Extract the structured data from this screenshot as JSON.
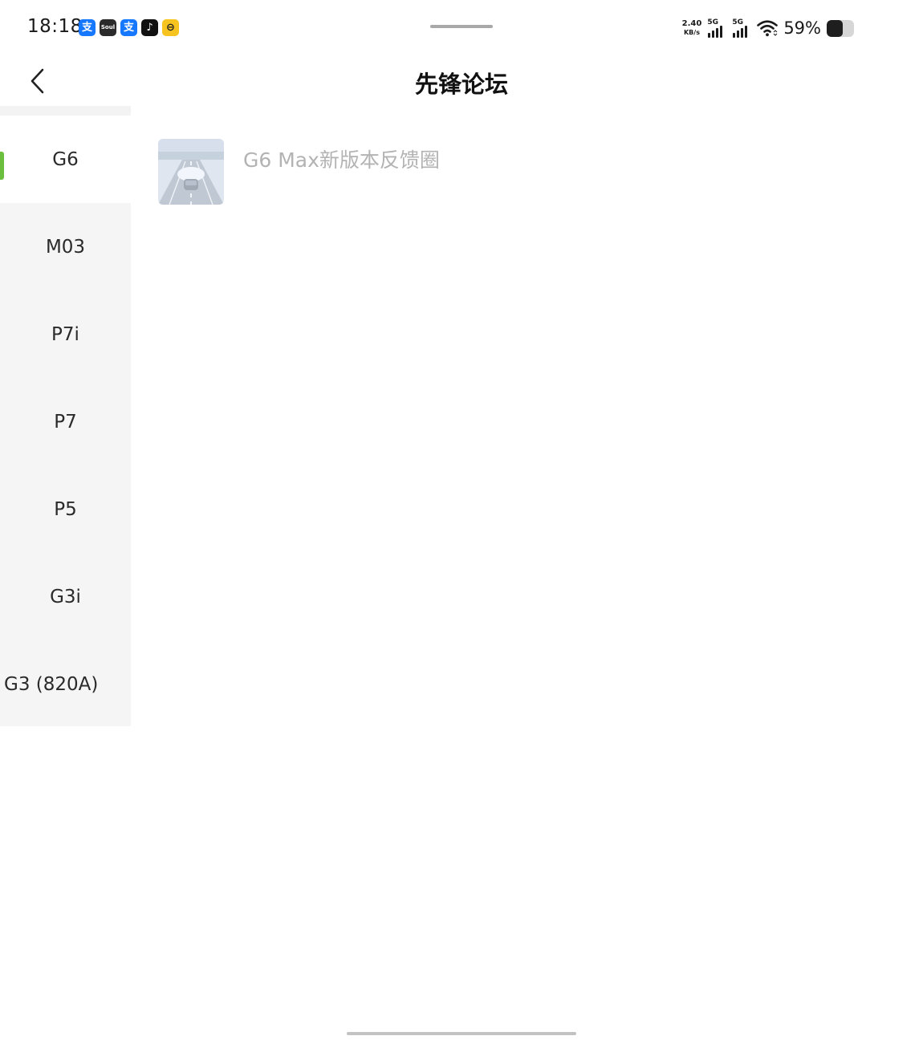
{
  "status_bar": {
    "time": "18:18",
    "net_speed_value": "2.40",
    "net_speed_unit": "KB/s",
    "signal_label_1": "5G",
    "signal_label_2": "5G",
    "battery_text": "59%",
    "battery_level": 0.59,
    "app_icons": [
      {
        "name": "alipay-icon",
        "glyph": "支"
      },
      {
        "name": "soul-icon",
        "glyph": "Soul"
      },
      {
        "name": "alipay-icon",
        "glyph": "支"
      },
      {
        "name": "tiktok-icon",
        "glyph": "♪"
      },
      {
        "name": "ride-app-icon",
        "glyph": "⊖"
      }
    ]
  },
  "header": {
    "title": "先锋论坛",
    "back_icon": "chevron-left-icon"
  },
  "sidebar": {
    "items": [
      {
        "label": "G6",
        "active": true
      },
      {
        "label": "M03",
        "active": false
      },
      {
        "label": "P7i",
        "active": false
      },
      {
        "label": "P7",
        "active": false
      },
      {
        "label": "P5",
        "active": false
      },
      {
        "label": "G3i",
        "active": false
      },
      {
        "label": "G3 (820A)",
        "active": false
      }
    ],
    "accent_color": "#6bbf3f"
  },
  "content": {
    "forums": [
      {
        "title": "G6 Max新版本反馈圈",
        "thumb_icon": "car-road-thumbnail"
      }
    ]
  }
}
